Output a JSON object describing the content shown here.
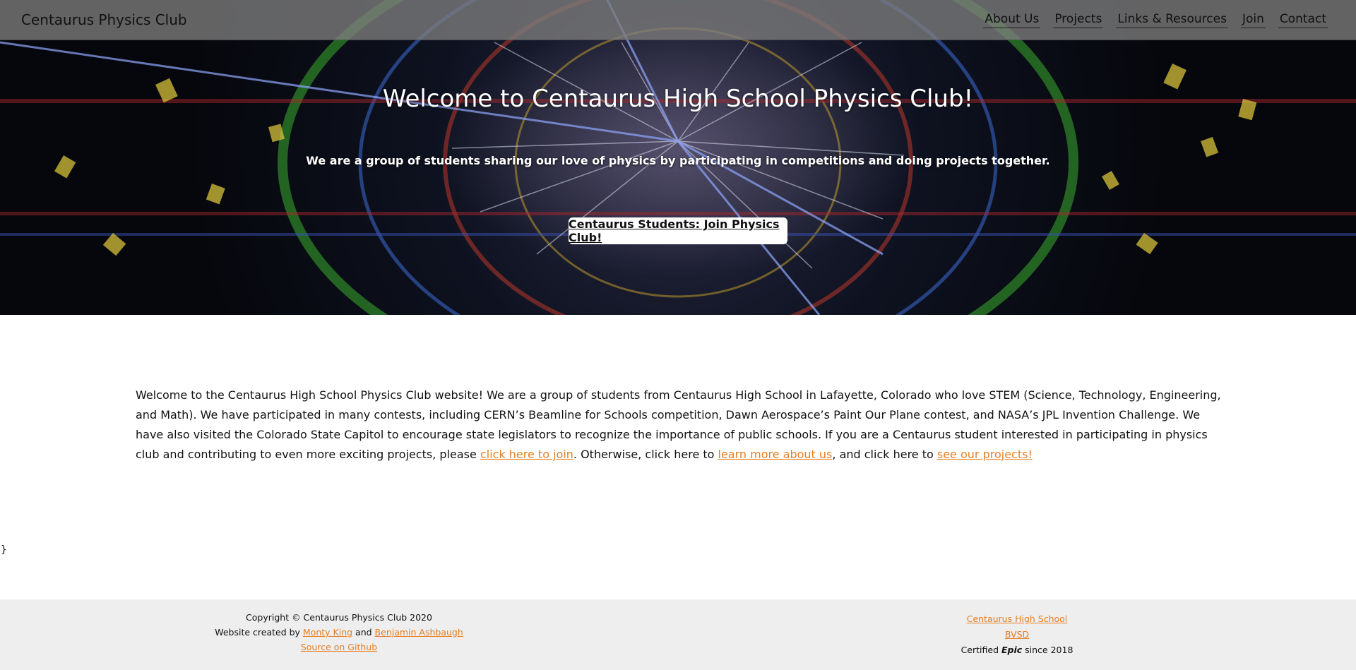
{
  "nav": {
    "brand": "Centaurus Physics Club",
    "links": [
      {
        "label": "About Us"
      },
      {
        "label": "Projects"
      },
      {
        "label": "Links & Resources"
      },
      {
        "label": "Join"
      },
      {
        "label": "Contact"
      }
    ]
  },
  "hero": {
    "title": "Welcome to Centaurus High School Physics Club!",
    "subtitle": "We are a group of students sharing our love of physics by participating in competitions and doing projects together.",
    "button_label": "Centaurus Students: Join Physics Club!"
  },
  "main": {
    "paragraph_text": "Welcome to the Centaurus High School Physics Club website! We are a group of students from Centaurus High School in Lafayette, Colorado who love STEM (Science, Technology, Engineering, and Math). We have participated in many contests, including CERN’s Beamline for Schools competition, Dawn Aerospace’s Paint Our Plane contest, and NASA’s JPL Invention Challenge. We have also visited the Colorado State Capitol to encourage state legislators to recognize the importance of public schools. If you are a Centaurus student interested in participating in physics club and contributing to even more exciting projects, please ",
    "join_link": "click here to join",
    "text_after_join": ". Otherwise, click here to ",
    "about_link": "learn more about us",
    "text_after_about": ", and click here to ",
    "projects_link": "see our projects!",
    "stray_text": "}"
  },
  "footer": {
    "copyright": "Copyright © Centaurus Physics Club 2020",
    "created_prefix": "Website created by ",
    "author1": "Monty King",
    "and_text": " and ",
    "author2": "Benjamin Ashbaugh",
    "source_link": "Source on Github",
    "school_link": "Centaurus High School",
    "district_link": "BVSD",
    "certified_prefix": "Certified ",
    "certified_epic": "Epic",
    "certified_suffix": " since 2018"
  },
  "colors": {
    "link_accent": "#e67e22",
    "footer_bg": "#eeeeee",
    "navbar_bg": "#7d7d7d"
  }
}
